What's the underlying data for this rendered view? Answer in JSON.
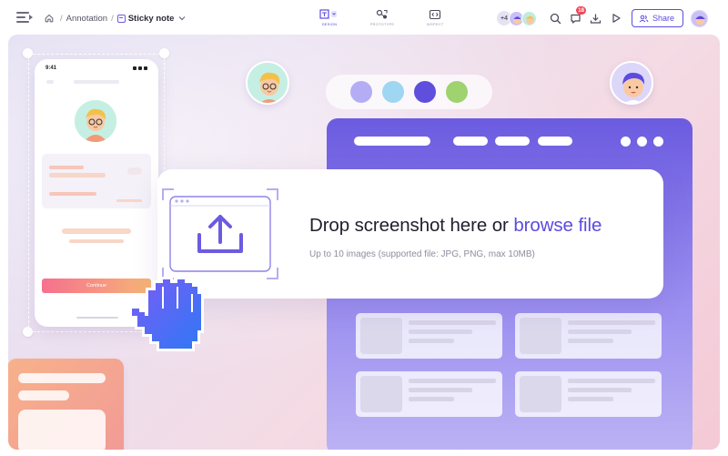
{
  "topbar": {
    "breadcrumb": {
      "project": "Annotation",
      "separator": "/",
      "document": "Sticky note"
    },
    "modes": [
      {
        "label": "Design",
        "active": true
      },
      {
        "label": "Prototype",
        "active": false
      },
      {
        "label": "Inspect",
        "active": false
      }
    ],
    "collaborators_extra": "+4",
    "notification_count": "18",
    "share_label": "Share"
  },
  "canvas": {
    "phone": {
      "time": "9:41",
      "continue_label": "Continue"
    },
    "palette": {
      "colors": [
        "#b4acf5",
        "#9fd6f2",
        "#5f4fdc",
        "#9ed36f"
      ]
    },
    "drop_zone": {
      "title": "Drop screenshot here or",
      "link": "browse file",
      "subtitle": "Up to 10 images (supported file: JPG, PNG, max 10MB)"
    }
  },
  "colors": {
    "accent": "#5b4be0",
    "badge": "#f0465a"
  }
}
